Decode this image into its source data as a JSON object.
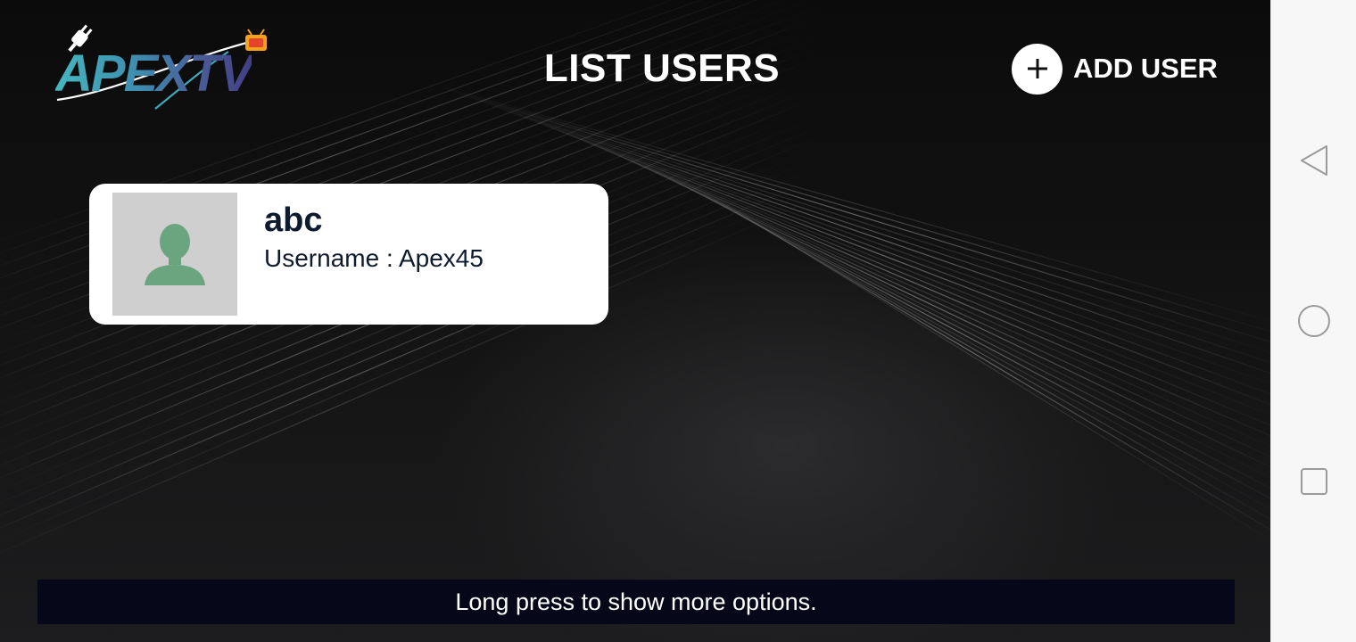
{
  "app": {
    "logo_text": "APEXTV",
    "title": "LIST USERS",
    "add_user_label": "ADD USER"
  },
  "users": [
    {
      "name": "abc",
      "username_text": "Username : Apex45"
    }
  ],
  "toast": {
    "message": "Long press to show more options."
  },
  "nav": {
    "buttons": [
      "back",
      "home",
      "recents"
    ]
  },
  "colors": {
    "logo_teal": "#46b6bf",
    "logo_indigo": "#3f3f85",
    "avatar_bg": "#d0cfcf",
    "avatar_figure": "#6aa57f",
    "card_text": "#0e1a2e",
    "toast_bg": "#07071a"
  }
}
